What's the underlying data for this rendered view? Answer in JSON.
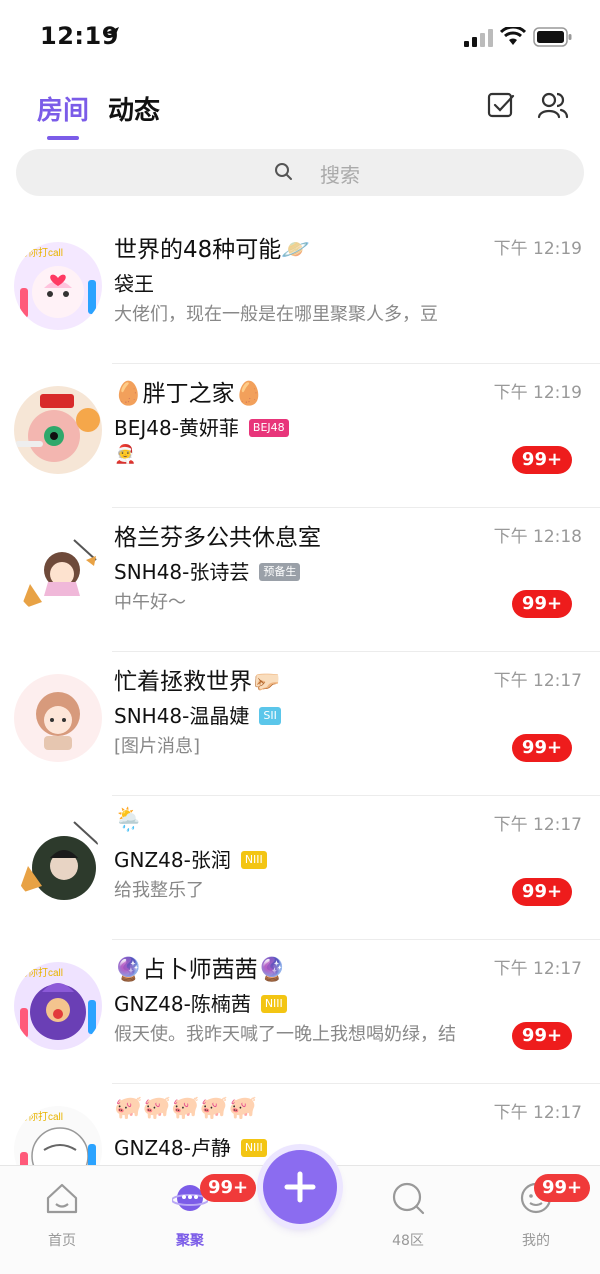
{
  "status": {
    "time": "12:19"
  },
  "header": {
    "tabs": [
      {
        "label": "房间",
        "active": true
      },
      {
        "label": "动态",
        "active": false
      }
    ]
  },
  "search": {
    "placeholder": "搜索"
  },
  "rooms": [
    {
      "title": "世界的48种可能🪐",
      "time": "下午 12:19",
      "subtitle": "袋王",
      "badge": "",
      "message": "大佬们，现在一般是在哪里聚聚人多，豆",
      "count": ""
    },
    {
      "title": "🥚胖丁之家🥚",
      "time": "下午 12:19",
      "subtitle": "BEJ48-黄妍菲",
      "badge": "BEJ48",
      "message": "🧑‍🎄",
      "count": "99+"
    },
    {
      "title": "格兰芬多公共休息室",
      "time": "下午 12:18",
      "subtitle": "SNH48-张诗芸",
      "badge": "预备生",
      "message": "中午好～",
      "count": "99+"
    },
    {
      "title": "忙着拯救世界🤛🏻",
      "time": "下午 12:17",
      "subtitle": "SNH48-温晶婕",
      "badge": "SII",
      "message": "[图片消息]",
      "count": "99+"
    },
    {
      "title": "🌦️",
      "time": "下午 12:17",
      "subtitle": "GNZ48-张润",
      "badge": "NIII",
      "message": "给我整乐了",
      "count": "99+"
    },
    {
      "title": "🔮占卜师茜茜🔮",
      "time": "下午 12:17",
      "subtitle": "GNZ48-陈楠茜",
      "badge": "NIII",
      "message": "假天使。我昨天喊了一晚上我想喝奶绿，结",
      "count": "99+"
    },
    {
      "title": "🐖🐖🐖🐖🐖",
      "time": "下午 12:17",
      "subtitle": "GNZ48-卢静",
      "badge": "NIII",
      "message": "",
      "count": ""
    }
  ],
  "badge_colors": {
    "BEJ48": "#e8357a",
    "预备生": "#9aa0a8",
    "SII": "#5bc6ea",
    "NIII": "#f3c513"
  },
  "tabbar": {
    "items": [
      {
        "label": "首页",
        "icon": "home-icon",
        "badge": ""
      },
      {
        "label": "聚聚",
        "icon": "planet-chat-icon",
        "badge": "99+"
      },
      {
        "label": "48区",
        "icon": "search-zone-icon",
        "badge": ""
      },
      {
        "label": "我的",
        "icon": "profile-icon",
        "badge": "99+"
      }
    ]
  },
  "accent": "#7b5ce8"
}
